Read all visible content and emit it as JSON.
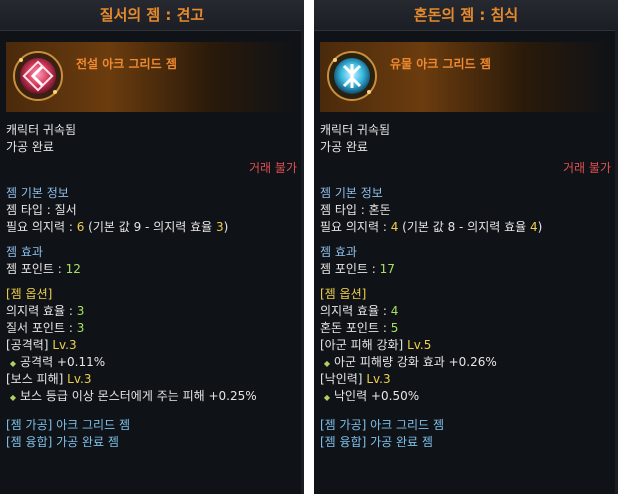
{
  "panels": [
    {
      "title": "질서의 젬 : 견고",
      "gem_name": "전설 아크 그리드 젬",
      "bound": "캐릭터 귀속됨",
      "processing": "가공 완료",
      "trade": "거래 불가",
      "basic_info_title": "젬 기본 정보",
      "gem_type_label": "젬 타입 : ",
      "gem_type_value": "질서",
      "will_label": "필요 의지력 : ",
      "will_value": "6",
      "will_detail_pre": " (기본 값 9 - 의지력 효율 ",
      "will_detail_val": "3",
      "will_detail_post": ")",
      "effect_title": "젬 효과",
      "points_label": "젬 포인트 : ",
      "points_value": "12",
      "options_title": "[젬 옵션]",
      "eff_label": "의지력 효율 : ",
      "eff_value": "3",
      "point2_label": "질서 포인트 : ",
      "point2_value": "3",
      "opt1_name": "[공격력] ",
      "opt1_lv": "Lv.3",
      "opt1_effect": "공격력 +0.11%",
      "opt2_name": "[보스 피해] ",
      "opt2_lv": "Lv.3",
      "opt2_effect": "보스 등급 이상 몬스터에게 주는 피해 +0.25%",
      "foot1_tag": "[젬 가공] ",
      "foot1_text": "아크 그리드 젬",
      "foot2_tag": "[젬 융합] ",
      "foot2_text": "가공 완료 젬",
      "gem_icon": "red-order-gem-icon",
      "gem_color": "#d23a5a"
    },
    {
      "title": "혼돈의 젬 : 침식",
      "gem_name": "유물 아크 그리드 젬",
      "bound": "캐릭터 귀속됨",
      "processing": "가공 완료",
      "trade": "거래 불가",
      "basic_info_title": "젬 기본 정보",
      "gem_type_label": "젬 타입 : ",
      "gem_type_value": "혼돈",
      "will_label": "필요 의지력 : ",
      "will_value": "4",
      "will_detail_pre": " (기본 값 8 - 의지력 효율 ",
      "will_detail_val": "4",
      "will_detail_post": ")",
      "effect_title": "젬 효과",
      "points_label": "젬 포인트 : ",
      "points_value": "17",
      "options_title": "[젬 옵션]",
      "eff_label": "의지력 효율 : ",
      "eff_value": "4",
      "point2_label": "혼돈 포인트 : ",
      "point2_value": "5",
      "opt1_name": "[아군 피해 강화] ",
      "opt1_lv": "Lv.5",
      "opt1_effect": "아군 피해량 강화 효과 +0.26%",
      "opt2_name": "[낙인력] ",
      "opt2_lv": "Lv.3",
      "opt2_effect": "낙인력 +0.50%",
      "foot1_tag": "[젬 가공] ",
      "foot1_text": "아크 그리드 젬",
      "foot2_tag": "[젬 융합] ",
      "foot2_text": "가공 완료 젬",
      "gem_icon": "blue-chaos-gem-icon",
      "gem_color": "#3ab8e0"
    }
  ],
  "colors": {
    "title": "#e68a2e",
    "untradable": "#e05050",
    "section": "#8fbfe8",
    "level": "#f0d04a",
    "value": "#a8e060"
  }
}
